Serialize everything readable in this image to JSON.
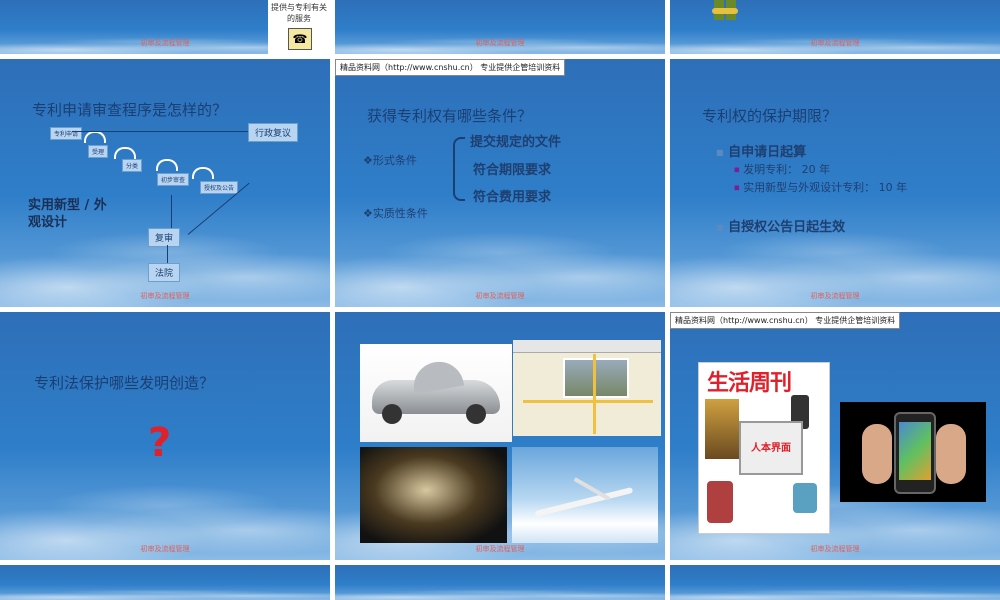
{
  "common": {
    "footer": "初审及流程管理",
    "banner": "精品资料网（http://www.cnshu.cn） 专业提供企管培训资料"
  },
  "slide1": {
    "text": "提供与专利有关的服务"
  },
  "slide4": {
    "title": "专利申请审查程序是怎样的？",
    "steps": [
      "专利申请",
      "受理",
      "分类",
      "初步审查",
      "授权及公告",
      "行政复议",
      "复审",
      "法院"
    ],
    "side_label": "实用新型 / 外观设计"
  },
  "slide5": {
    "title": "获得专利权有哪些条件？",
    "formal": "形式条件",
    "material": "实质性条件",
    "reqs": [
      "提交规定的文件",
      "符合期限要求",
      "符合费用要求"
    ]
  },
  "slide6": {
    "title": "专利权的保护期限？",
    "b1": "自申请日起算",
    "s1": "发明专利： 20 年",
    "s2": "实用新型与外观设计专利： 10 年",
    "b2": "自授权公告日起生效"
  },
  "slide7": {
    "title": "专利法保护哪些发明创造？",
    "mark": "?"
  },
  "slide9": {
    "mag_title": "生活周刊",
    "mag_sub": "人本界面"
  },
  "colors": {
    "footer": "#e0605a",
    "accent_red": "#e0202a",
    "title_blue": "#1a3f73"
  }
}
